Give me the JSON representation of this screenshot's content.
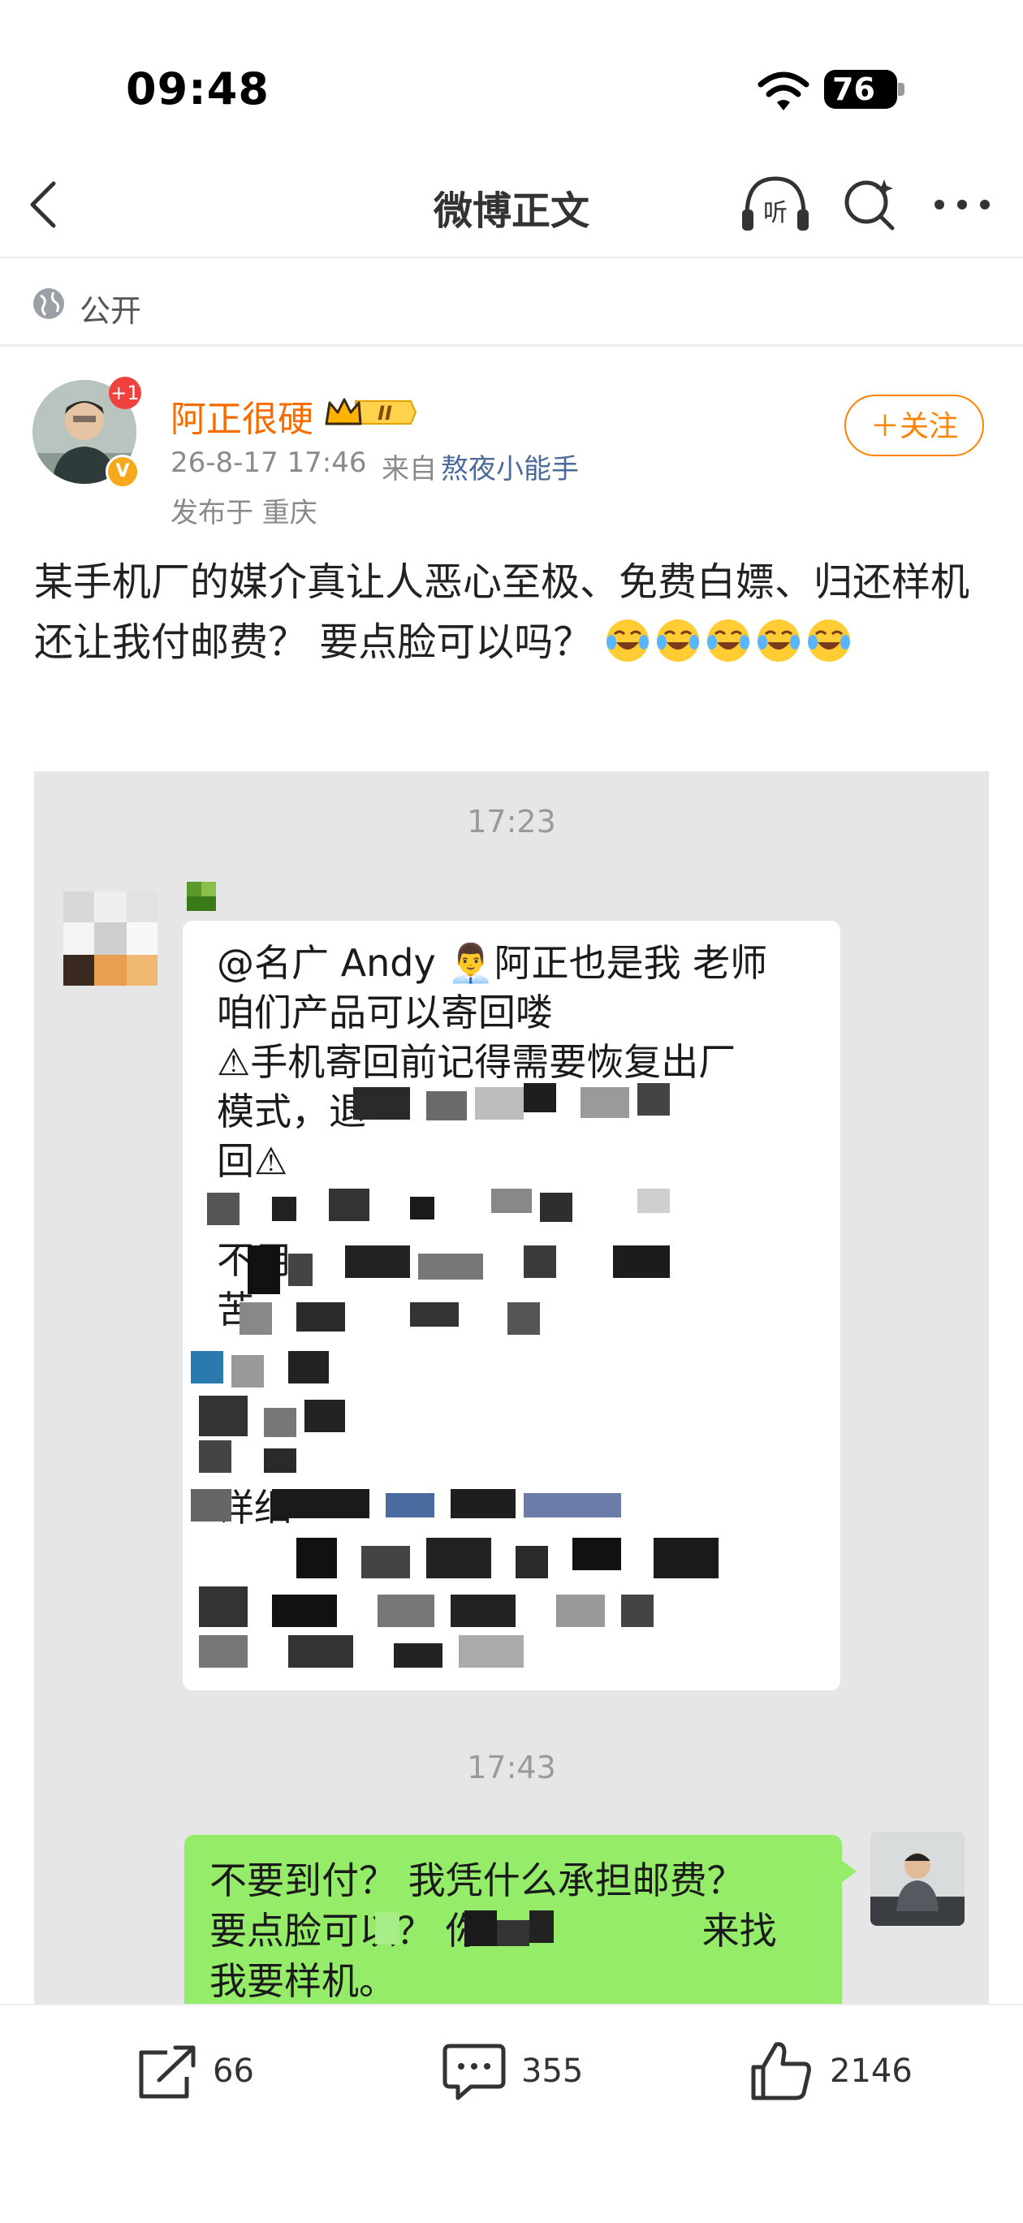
{
  "status_bar": {
    "time": "09:48",
    "battery": "76"
  },
  "nav": {
    "title": "微博正文",
    "listen_label": "听"
  },
  "visibility": "公开",
  "author": {
    "name": "阿正很硬",
    "avatar_badge": "+1",
    "verified_badge": "V",
    "level_badge": "II",
    "time": "26-8-17 17:46",
    "source_prefix": "来自",
    "source_app": "熬夜小能手",
    "location": "发布于 重庆",
    "follow_label": "＋关注"
  },
  "post": {
    "text": "某手机厂的媒介真让人恶心至极、免费白嫖、归还样机还让我付邮费？ 要点脸可以吗？"
  },
  "chat_image": {
    "timestamp1": "17:23",
    "message1_lines": [
      "@名广 Andy 👨‍💼阿正也是我 老师",
      "咱们产品可以寄回喽",
      "⚠手机寄回前记得需要恢复出厂",
      "模式，退",
      "回⚠",
      "",
      "不用",
      "苦",
      "",
      "",
      "",
      "详细",
      "",
      ""
    ],
    "timestamp2": "17:43",
    "message2_lines": [
      "不要到付？ 我凭什么承担邮费？",
      "要点脸可以？ 你",
      "我要样机。"
    ],
    "message2_partial": "来找"
  },
  "actions": {
    "repost_count": "66",
    "comment_count": "355",
    "like_count": "2146"
  },
  "colors": {
    "orange_name": "#f56c00",
    "follow_orange": "#ff8200",
    "chat_green": "#95ec69",
    "link_blue": "#4a6b9a"
  }
}
